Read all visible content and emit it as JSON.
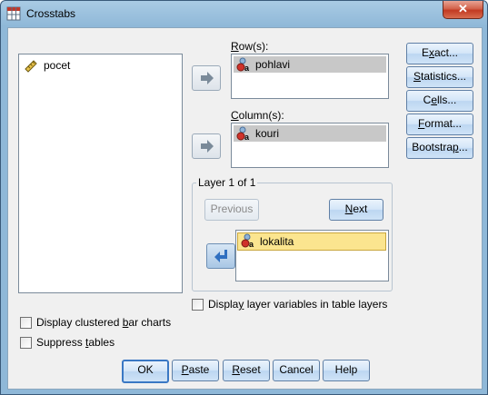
{
  "window": {
    "title": "Crosstabs",
    "close_glyph": "✕"
  },
  "source_list": {
    "items": [
      {
        "label": "pocet",
        "icon": "ruler-scale-icon"
      }
    ]
  },
  "rows": {
    "label_pre": "",
    "label_mn": "R",
    "label_post": "ow(s):",
    "items": [
      {
        "label": "pohlavi",
        "icon": "nominal-variable-icon"
      }
    ]
  },
  "columns": {
    "label_pre": "",
    "label_mn": "C",
    "label_post": "olumn(s):",
    "items": [
      {
        "label": "kouri",
        "icon": "nominal-variable-icon"
      }
    ]
  },
  "layer": {
    "title": "Layer 1 of 1",
    "previous_label": "Previous",
    "next_pre": "",
    "next_mn": "N",
    "next_post": "ext",
    "items": [
      {
        "label": "lokalita",
        "icon": "nominal-variable-icon"
      }
    ]
  },
  "side_buttons": {
    "exact": {
      "pre": "E",
      "mn": "x",
      "post": "act..."
    },
    "statistics": {
      "pre": "",
      "mn": "S",
      "post": "tatistics..."
    },
    "cells": {
      "pre": "C",
      "mn": "e",
      "post": "lls..."
    },
    "format": {
      "pre": "",
      "mn": "F",
      "post": "ormat..."
    },
    "bootstrap": {
      "pre": "Bootstra",
      "mn": "p",
      "post": "..."
    }
  },
  "checkboxes": {
    "display_layer": {
      "pre": "Displa",
      "mn": "y",
      "post": " layer variables in table layers",
      "checked": false
    },
    "clustered_bars": {
      "pre": "Display clustered ",
      "mn": "b",
      "post": "ar charts",
      "checked": false
    },
    "suppress": {
      "pre": "Suppress ",
      "mn": "t",
      "post": "ables",
      "checked": false
    }
  },
  "bottom_buttons": {
    "ok": {
      "label": "OK"
    },
    "paste": {
      "pre": "",
      "mn": "P",
      "post": "aste"
    },
    "reset": {
      "pre": "",
      "mn": "R",
      "post": "eset"
    },
    "cancel": {
      "label": "Cancel"
    },
    "help": {
      "label": "Help"
    }
  },
  "colors": {
    "title_bar": "#8fb8d8",
    "dialog_bg": "#f0f0f0",
    "selection_gray": "#c8c8c8",
    "selection_yellow": "#fbe58f",
    "close_red": "#c23a22"
  }
}
